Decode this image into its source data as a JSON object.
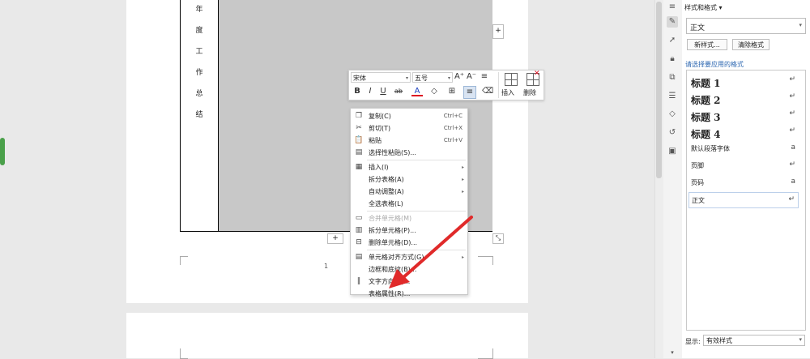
{
  "document": {
    "vertical_title": [
      "年",
      "度",
      "工",
      "作",
      "总",
      "结"
    ],
    "page_number": "1",
    "add_row_symbol": "+",
    "add_col_symbol": "+",
    "resize_symbol": "⤡"
  },
  "mini_toolbar": {
    "font_name": "宋体",
    "font_size": "五号",
    "grow_font": "A⁺",
    "shrink_font": "A⁻",
    "line_spacing": "≡",
    "bold": "B",
    "italic": "I",
    "underline": "U",
    "strikethrough": "ab",
    "font_color": "A",
    "fill": "◇",
    "borders": "⊞",
    "align": "≡",
    "eraser": "⌫",
    "insert_label": "插入",
    "delete_label": "删除"
  },
  "context_menu": {
    "items": [
      {
        "icon": "copy-icon",
        "glyph": "❐",
        "label": "复制(C)",
        "shortcut": "Ctrl+C",
        "arrow": "",
        "disabled": false
      },
      {
        "icon": "cut-icon",
        "glyph": "✂",
        "label": "剪切(T)",
        "shortcut": "Ctrl+X",
        "arrow": "",
        "disabled": false
      },
      {
        "icon": "paste-icon",
        "glyph": "📋",
        "label": "粘贴",
        "shortcut": "Ctrl+V",
        "arrow": "",
        "disabled": false
      },
      {
        "icon": "paste-special-icon",
        "glyph": "▤",
        "label": "选择性粘贴(S)...",
        "shortcut": "",
        "arrow": "",
        "disabled": false
      },
      {
        "icon": "insert-table-icon",
        "glyph": "▦",
        "label": "插入(I)",
        "shortcut": "",
        "arrow": "▸",
        "disabled": false
      },
      {
        "icon": "",
        "glyph": "",
        "label": "拆分表格(A)",
        "shortcut": "",
        "arrow": "▸",
        "disabled": false
      },
      {
        "icon": "",
        "glyph": "",
        "label": "自动调整(A)",
        "shortcut": "",
        "arrow": "▸",
        "disabled": false
      },
      {
        "icon": "",
        "glyph": "",
        "label": "全选表格(L)",
        "shortcut": "",
        "arrow": "",
        "disabled": false
      },
      {
        "icon": "merge-cells-icon",
        "glyph": "▭",
        "label": "合并单元格(M)",
        "shortcut": "",
        "arrow": "",
        "disabled": true
      },
      {
        "icon": "split-cells-icon",
        "glyph": "▥",
        "label": "拆分单元格(P)...",
        "shortcut": "",
        "arrow": "",
        "disabled": false
      },
      {
        "icon": "delete-cells-icon",
        "glyph": "⊟",
        "label": "删除单元格(D)...",
        "shortcut": "",
        "arrow": "",
        "disabled": false
      },
      {
        "icon": "cell-align-icon",
        "glyph": "▤",
        "label": "单元格对齐方式(G)",
        "shortcut": "",
        "arrow": "▸",
        "disabled": false
      },
      {
        "icon": "",
        "glyph": "",
        "label": "边框和底纹(B)...",
        "shortcut": "",
        "arrow": "",
        "disabled": false
      },
      {
        "icon": "text-direction-icon",
        "glyph": "‖",
        "label": "文字方向(X)...",
        "shortcut": "",
        "arrow": "",
        "disabled": false
      },
      {
        "icon": "",
        "glyph": "",
        "label": "表格属性(R)...",
        "shortcut": "",
        "arrow": "",
        "disabled": false
      }
    ]
  },
  "styles_panel": {
    "title": "样式和格式",
    "current_style": "正文",
    "new_style_button": "新样式...",
    "clear_format_button": "清除格式",
    "apply_label": "请选择要应用的格式",
    "styles": [
      {
        "name": "标题 1",
        "mark": "↵",
        "kind": "heading"
      },
      {
        "name": "标题 2",
        "mark": "↵",
        "kind": "heading"
      },
      {
        "name": "标题 3",
        "mark": "↵",
        "kind": "heading"
      },
      {
        "name": "标题 4",
        "mark": "↵",
        "kind": "heading"
      },
      {
        "name": "默认段落字体",
        "mark": "a",
        "kind": "normal"
      },
      {
        "name": "页脚",
        "mark": "↵",
        "kind": "normal"
      },
      {
        "name": "页码",
        "mark": "a",
        "kind": "normal"
      },
      {
        "name": "正文",
        "mark": "↵",
        "kind": "normal"
      }
    ],
    "show_label": "显示:",
    "show_value": "有效样式"
  },
  "colors": {
    "accent_arrow": "#e02a2a",
    "cell_gray": "#c8c8c8",
    "link_blue": "#2b66b0"
  }
}
